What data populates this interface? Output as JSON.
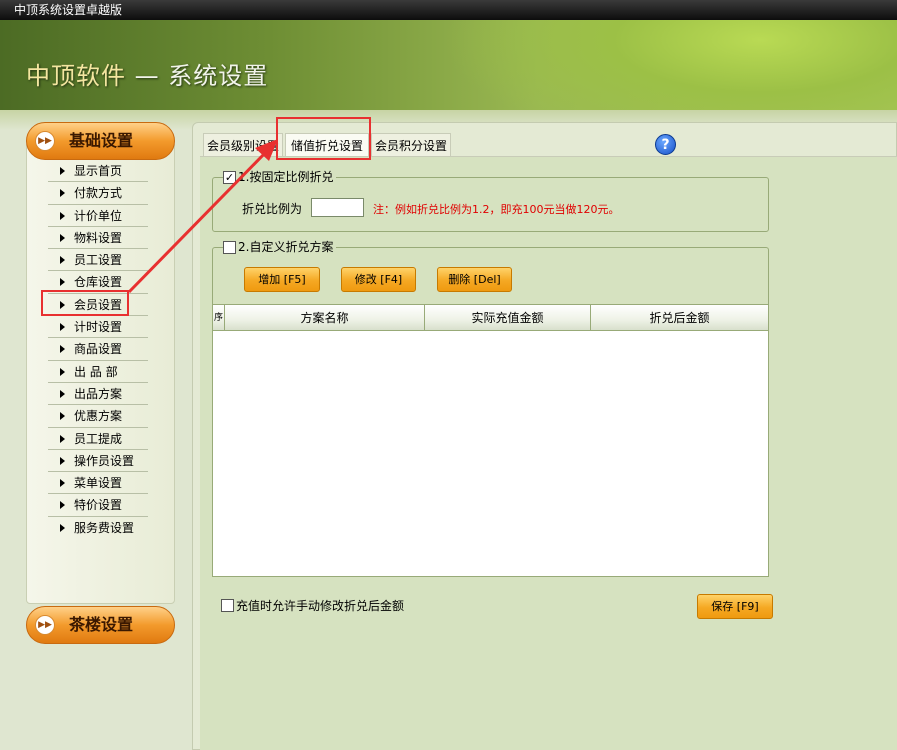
{
  "window": {
    "title": "中顶系统设置卓越版"
  },
  "header": {
    "brand": "中顶软件",
    "separator": " — ",
    "title": "系统设置"
  },
  "sidebar": {
    "category_basic": "基础设置",
    "category_tea": "茶楼设置",
    "items": [
      "显示首页",
      "付款方式",
      "计价单位",
      "物料设置",
      "员工设置",
      "仓库设置",
      "会员设置",
      "计时设置",
      "商品设置",
      "出 品 部",
      "出品方案",
      "优惠方案",
      "员工提成",
      "操作员设置",
      "菜单设置",
      "特价设置",
      "服务费设置"
    ],
    "selected": "会员设置"
  },
  "tabs": [
    "会员级别设置",
    "储值折兑设置",
    "会员积分设置"
  ],
  "active_tab": "储值折兑设置",
  "help_icon": "?",
  "fixed_ratio": {
    "label": "1.按固定比例折兑",
    "checked": true,
    "check_mark": "✓",
    "ratio_label": "折兑比例为",
    "ratio_value": "",
    "note": "注：例如折兑比例为1.2，即充100元当做120元。"
  },
  "custom_scheme": {
    "label": "2.自定义折兑方案",
    "checked": false,
    "buttons": {
      "add": "增加 [F5]",
      "edit": "修改 [F4]",
      "delete": "删除 [Del]"
    },
    "columns": [
      "序",
      "方案名称",
      "实际充值金额",
      "折兑后金额"
    ],
    "rows": []
  },
  "allow_manual": {
    "label": "充值时允许手动修改折兑后金额",
    "checked": false
  },
  "save_button": "保存 [F9]",
  "colors": {
    "annotation": "#e83030",
    "accent_orange": "#f5a823",
    "header_green": "#9cc046"
  }
}
